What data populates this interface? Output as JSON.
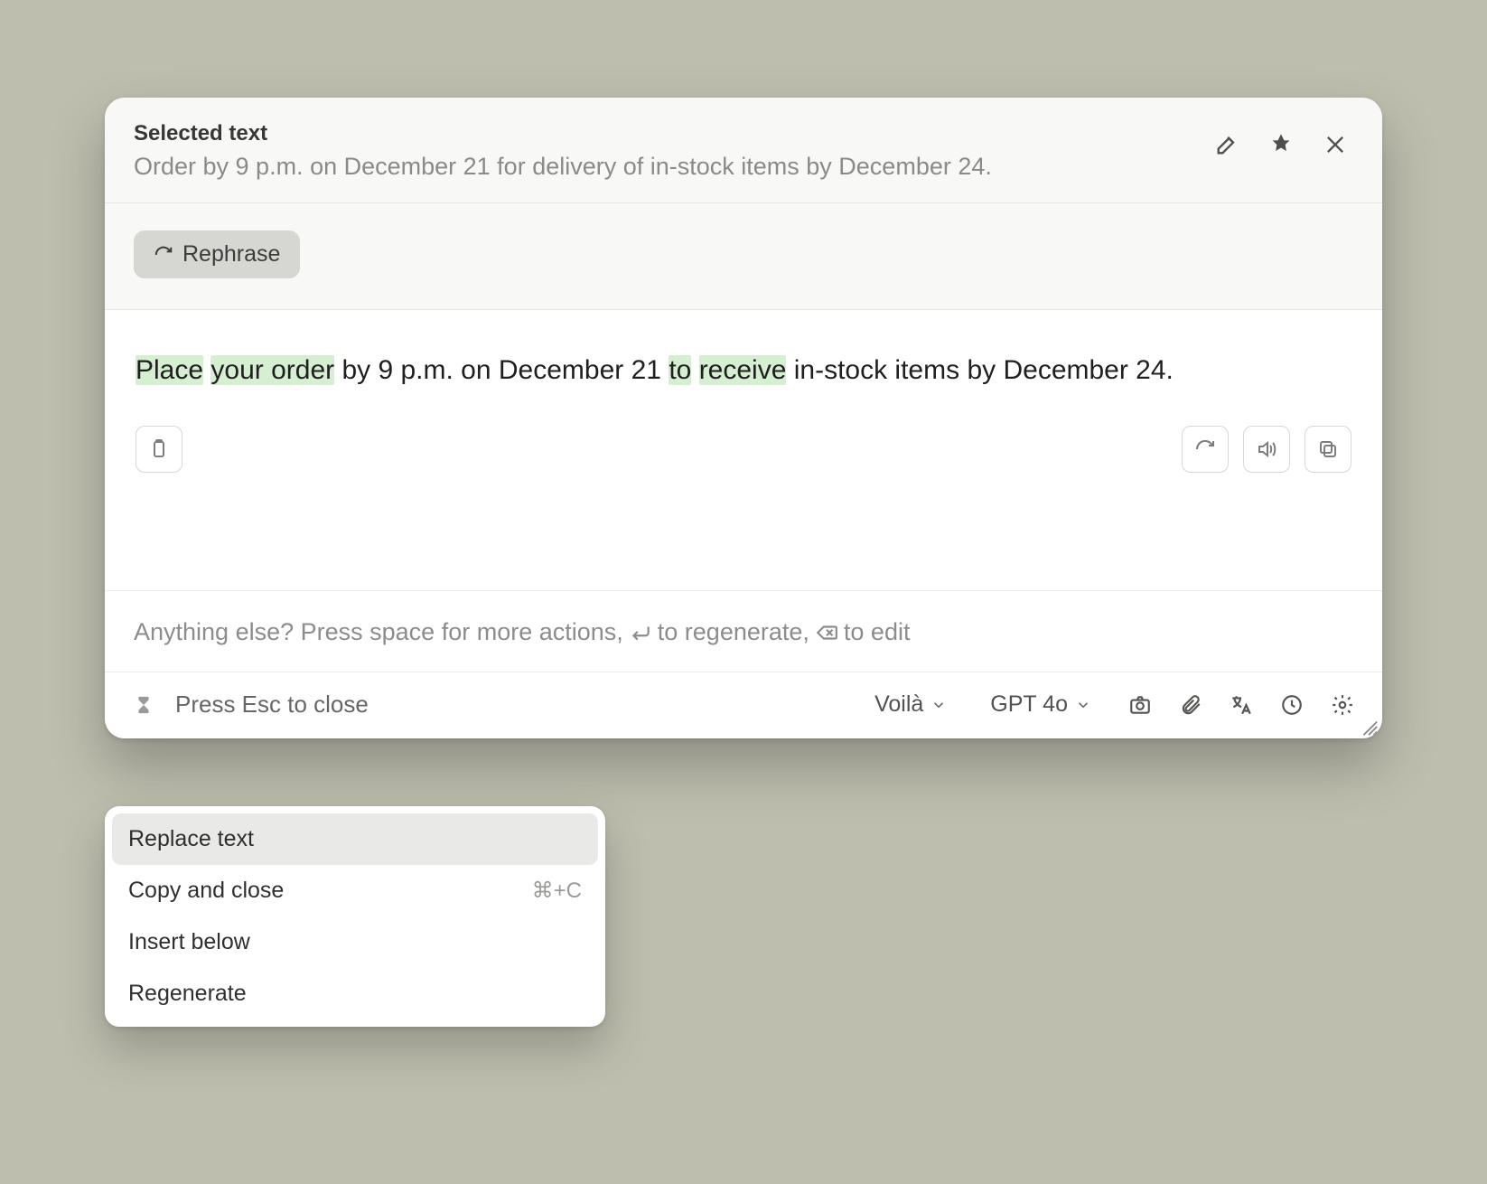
{
  "header": {
    "label": "Selected text",
    "subtitle": "Order by 9 p.m. on December 21 for delivery of in-stock items by December 24."
  },
  "chip": {
    "label": "Rephrase"
  },
  "result": {
    "segments": [
      {
        "text": "Place",
        "hl": true
      },
      {
        "text": " ",
        "hl": false
      },
      {
        "text": "your order",
        "hl": true
      },
      {
        "text": " by 9 p.m. on December 21 ",
        "hl": false
      },
      {
        "text": "to",
        "hl": true
      },
      {
        "text": " ",
        "hl": false
      },
      {
        "text": "receive",
        "hl": true
      },
      {
        "text": " in-stock items by December 24.",
        "hl": false
      }
    ]
  },
  "hint": {
    "p1": "Anything else? Press space for more actions, ",
    "p2": " to regenerate, ",
    "p3": " to edit"
  },
  "footer": {
    "esc": "Press Esc to close",
    "brand": "Voilà",
    "model": "GPT 4o"
  },
  "menu": {
    "items": [
      {
        "label": "Replace text",
        "shortcut": "",
        "hover": true
      },
      {
        "label": "Copy and close",
        "shortcut": "⌘+C",
        "hover": false
      },
      {
        "label": "Insert below",
        "shortcut": "",
        "hover": false
      },
      {
        "label": "Regenerate",
        "shortcut": "",
        "hover": false
      }
    ]
  }
}
